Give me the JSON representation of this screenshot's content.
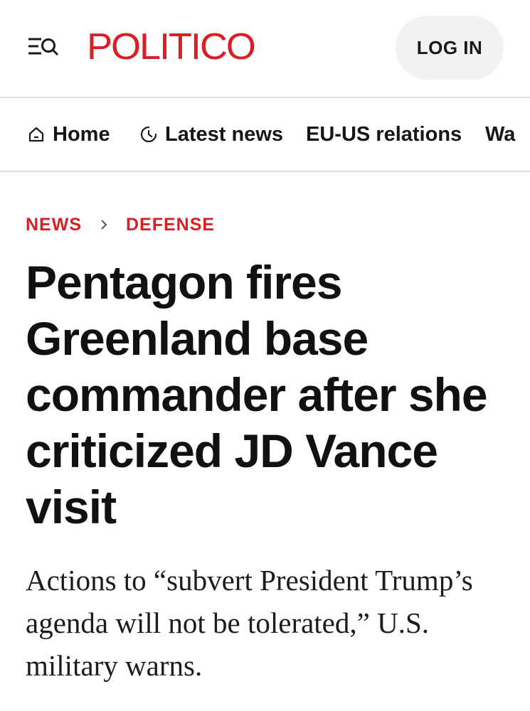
{
  "header": {
    "logo_text": "POLITICO",
    "login_label": "LOG IN",
    "menu_icon": "menu-search-icon",
    "brand_color": "#d91f26"
  },
  "nav": {
    "items": [
      {
        "label": "Home",
        "icon": "home-icon"
      },
      {
        "label": "Latest news",
        "icon": "clock-icon"
      },
      {
        "label": "EU-US relations"
      },
      {
        "label": "Wa"
      }
    ]
  },
  "breadcrumb": {
    "items": [
      "NEWS",
      "DEFENSE"
    ],
    "separator_icon": "chevron-right-icon"
  },
  "article": {
    "headline": "Pentagon fires Greenland base commander after she criticized JD Vance visit",
    "dek": "Actions to “subvert President Trump’s agenda will not be tolerated,” U.S. military warns."
  }
}
